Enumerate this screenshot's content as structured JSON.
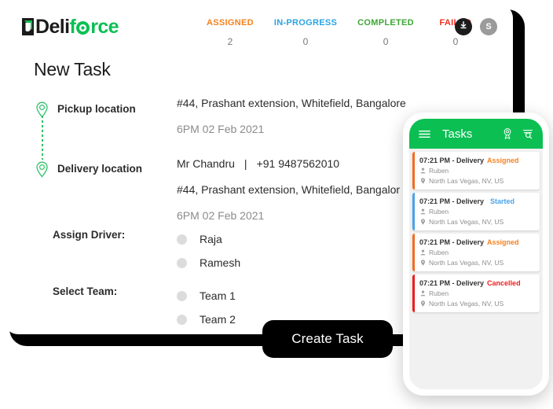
{
  "app": {
    "logo_dark": "Deli",
    "logo_green": "force"
  },
  "statuses": [
    {
      "label": "ASSIGNED",
      "count": "2",
      "color": "#F58220"
    },
    {
      "label": "IN-PROGRESS",
      "count": "0",
      "color": "#29A3E3"
    },
    {
      "label": "COMPLETED",
      "count": "0",
      "color": "#3FA535"
    },
    {
      "label": "FAILED",
      "count": "0",
      "color": "#EE2E24"
    }
  ],
  "top_icons": {
    "download": "download-icon",
    "avatar_initial": "S"
  },
  "page": {
    "title": "New Task"
  },
  "pickup": {
    "label": "Pickup location",
    "address": "#44, Prashant extension, Whitefield, Bangalore",
    "datetime": "6PM 02 Feb 2021"
  },
  "delivery": {
    "label": "Delivery location",
    "contact_name": "Mr Chandru",
    "separator": "|",
    "contact_phone": "+91 9487562010",
    "address": "#44, Prashant extension, Whitefield, Bangalor",
    "datetime": "6PM 02 Feb 2021"
  },
  "assign_driver": {
    "label": "Assign Driver:",
    "options": [
      "Raja",
      "Ramesh"
    ]
  },
  "select_team": {
    "label": "Select Team:",
    "options": [
      "Team 1",
      "Team 2"
    ]
  },
  "create_button": {
    "label": "Create Task"
  },
  "phone": {
    "header": {
      "menu_icon": "hamburger-menu-icon",
      "title": "Tasks",
      "pin_icon": "map-pin-icon",
      "search_icon": "search-icon"
    },
    "tasks": [
      {
        "time_type": "07:21 PM - Delivery",
        "status": "Assigned",
        "status_color": "#F58220",
        "bar_color": "#F26C21",
        "driver": "Ruben",
        "location": "North Las Vegas, NV, US"
      },
      {
        "time_type": "07:21 PM - Delivery",
        "status": "Started",
        "status_color": "#4AA3E8",
        "bar_color": "#4AA3E8",
        "driver": "Ruben",
        "location": "North Las Vegas, NV, US"
      },
      {
        "time_type": "07:21 PM - Delivery",
        "status": "Assigned",
        "status_color": "#F58220",
        "bar_color": "#F26C21",
        "driver": "Ruben",
        "location": "North Las Vegas, NV, US"
      },
      {
        "time_type": "07:21 PM - Delivery",
        "status": "Cancelled",
        "status_color": "#F01E1E",
        "bar_color": "#EE1C1C",
        "driver": "Ruben",
        "location": "North Las Vegas, NV, US"
      }
    ]
  },
  "theme": {
    "brand_green": "#0CBF53",
    "pin_green": "#2EC36A",
    "black": "#000000"
  }
}
